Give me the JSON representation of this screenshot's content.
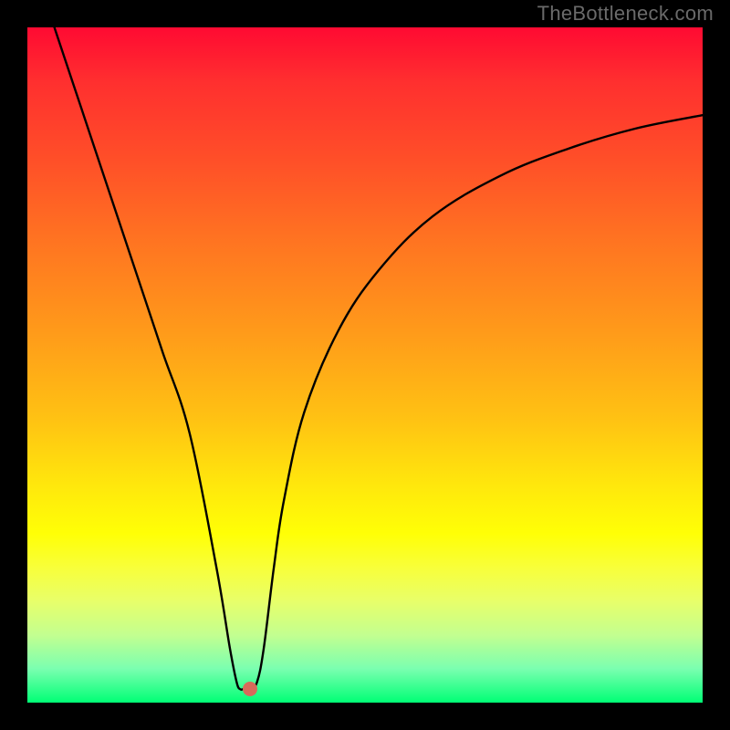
{
  "watermark": "TheBottleneck.com",
  "chart_data": {
    "type": "line",
    "title": "",
    "xlabel": "",
    "ylabel": "",
    "xlim": [
      0,
      100
    ],
    "ylim": [
      0,
      100
    ],
    "series": [
      {
        "name": "curve",
        "x": [
          4,
          8,
          12,
          16,
          20,
          24,
          28,
          30,
          31,
          31.5,
          32,
          32.5,
          33,
          34,
          35,
          36.5,
          38,
          41,
          46,
          52,
          60,
          70,
          80,
          90,
          100
        ],
        "values": [
          100,
          88,
          76,
          64,
          52,
          40,
          20,
          8,
          3,
          2,
          2,
          2,
          2,
          3,
          8,
          20,
          30,
          43,
          55,
          64,
          72,
          78,
          82,
          85,
          87
        ]
      }
    ],
    "marker": {
      "x": 33,
      "y": 2,
      "color": "#d76a5a"
    },
    "background_gradient_top": "#ff0a32",
    "background_gradient_bottom": "#00ff75",
    "frame_color": "#000000"
  }
}
